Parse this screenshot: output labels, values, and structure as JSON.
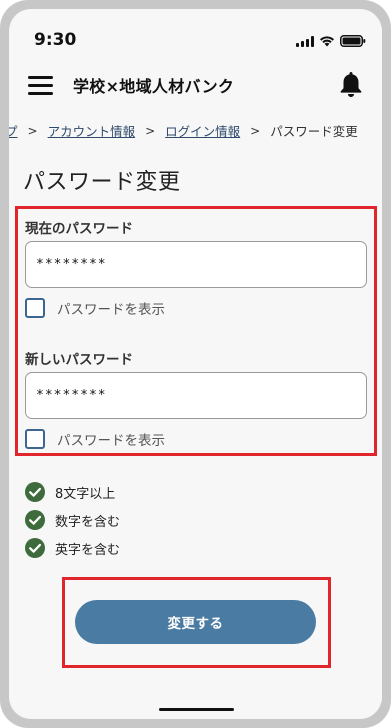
{
  "status_bar": {
    "time": "9:30"
  },
  "header": {
    "title": "学校×地域人材バンク"
  },
  "breadcrumb": {
    "items": [
      "プ",
      "アカウント情報",
      "ログイン情報",
      "パスワード変更"
    ],
    "separator": ">"
  },
  "page": {
    "title": "パスワード変更"
  },
  "form": {
    "current_password": {
      "label": "現在のパスワード",
      "value": "********",
      "show_label": "パスワードを表示",
      "show_checked": false
    },
    "new_password": {
      "label": "新しいパスワード",
      "value": "********",
      "show_label": "パスワードを表示",
      "show_checked": false
    }
  },
  "rules": [
    {
      "text": "8文字以上",
      "met": true
    },
    {
      "text": "数字を含む",
      "met": true
    },
    {
      "text": "英字を含む",
      "met": true
    }
  ],
  "submit": {
    "label": "変更する"
  },
  "colors": {
    "primary": "#4a7ba3",
    "check_green": "#3d6b3c",
    "highlight_red": "#e0252d",
    "link": "#2f4a6b"
  },
  "icons": {
    "menu": "hamburger-menu-icon",
    "notification": "bell-icon",
    "rule_met": "check-circle-icon"
  }
}
